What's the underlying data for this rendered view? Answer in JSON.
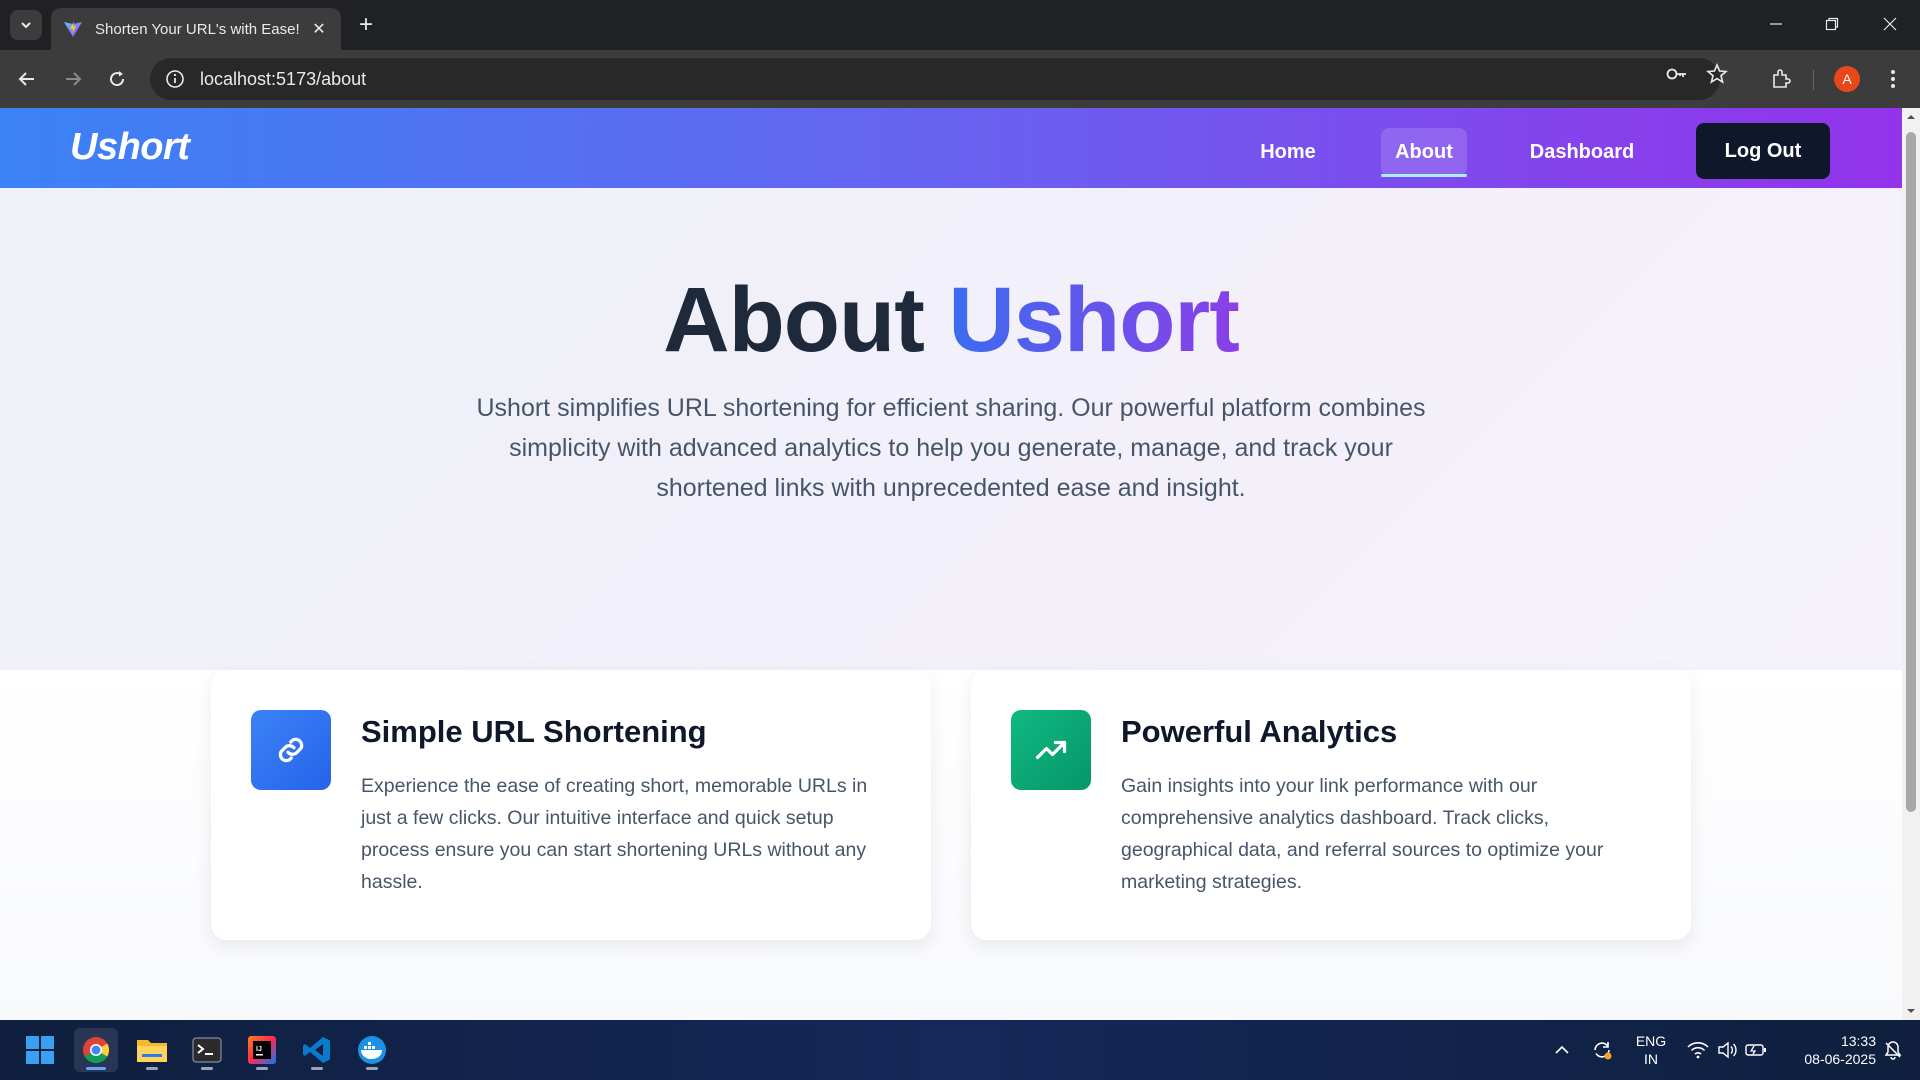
{
  "browser": {
    "tab_title": "Shorten Your URL's with Ease!",
    "url": "localhost:5173/about",
    "profile_initial": "A"
  },
  "navbar": {
    "brand": "Ushort",
    "links": [
      "Home",
      "About",
      "Dashboard"
    ],
    "active_link": "About",
    "logout_label": "Log Out"
  },
  "hero": {
    "title_plain": "About",
    "title_accent": "Ushort",
    "description": "Ushort simplifies URL shortening for efficient sharing. Our powerful platform combines simplicity with advanced analytics to help you generate, manage, and track your shortened links with unprecedented ease and insight."
  },
  "features": [
    {
      "icon": "link-icon",
      "title": "Simple URL Shortening",
      "text": "Experience the ease of creating short, memorable URLs in just a few clicks. Our intuitive interface and quick setup process ensure you can start shortening URLs without any hassle.",
      "color": "#3b82f6"
    },
    {
      "icon": "trending-up-icon",
      "title": "Powerful Analytics",
      "text": "Gain insights into your link performance with our comprehensive analytics dashboard. Track clicks, geographical data, and referral sources to optimize your marketing strategies.",
      "color": "#10b981"
    }
  ],
  "taskbar": {
    "language": "ENG",
    "region": "IN",
    "time": "13:33",
    "date": "08-06-2025"
  },
  "colors": {
    "nav_gradient_start": "#3b82f6",
    "nav_gradient_end": "#9333ea",
    "logout_bg": "#0f172a",
    "heading": "#1e293b"
  }
}
